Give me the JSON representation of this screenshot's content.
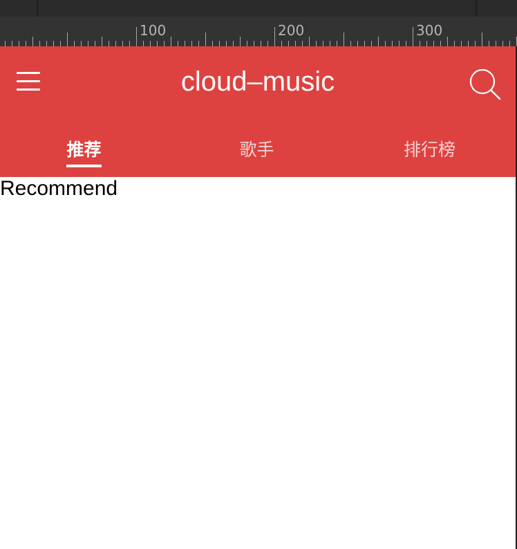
{
  "ruler": {
    "labels": [
      "100",
      "200",
      "300"
    ]
  },
  "app": {
    "title": "cloud–music",
    "menu_icon": "hamburger-menu-icon",
    "search_icon": "search-icon"
  },
  "tabs": [
    {
      "label": "推荐",
      "active": true
    },
    {
      "label": "歌手",
      "active": false
    },
    {
      "label": "排行榜",
      "active": false
    }
  ],
  "content": {
    "text": "Recommend"
  },
  "colors": {
    "header_background": "#dd4240",
    "devtools_background": "#2b2b2b",
    "ruler_background": "#333333"
  }
}
